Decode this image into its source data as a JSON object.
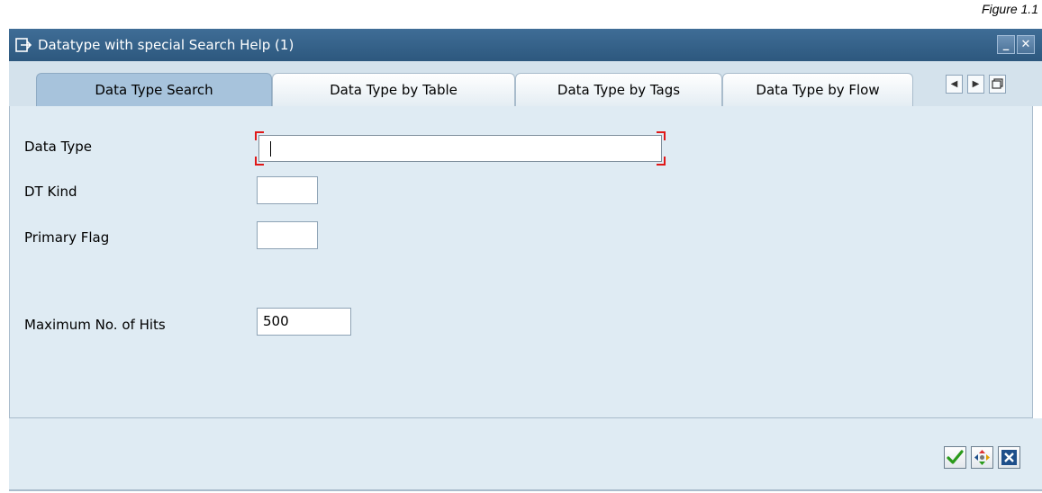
{
  "figure_caption": "Figure 1.1",
  "window": {
    "title": "Datatype with special Search Help (1)",
    "minimize_icon": "minimize-icon",
    "close_icon": "close-icon"
  },
  "tabs": [
    {
      "label": "Data Type Search",
      "active": true
    },
    {
      "label": "Data Type by Table",
      "active": false
    },
    {
      "label": "Data Type by Tags",
      "active": false
    },
    {
      "label": "Data Type by Flow",
      "active": false
    }
  ],
  "tab_nav": [
    "tab-scroll-left-icon",
    "tab-scroll-right-icon",
    "tab-list-icon"
  ],
  "form": {
    "data_type": {
      "label": "Data Type",
      "value": "",
      "required": true
    },
    "dt_kind": {
      "label": "DT Kind",
      "value": ""
    },
    "primary_flag": {
      "label": "Primary Flag",
      "value": ""
    },
    "max_hits": {
      "label": "Maximum No. of Hits",
      "value": "500"
    }
  },
  "footer_buttons": [
    "confirm-check-icon",
    "multiple-selection-icon",
    "cancel-x-icon"
  ],
  "colors": {
    "titlebar": "#2d587e",
    "tab_active": "#a7c3dc",
    "panel": "#dfebf3",
    "required_marker": "#e01818",
    "confirm_green": "#2a9a1a",
    "cancel_blue": "#1e4f8a"
  }
}
